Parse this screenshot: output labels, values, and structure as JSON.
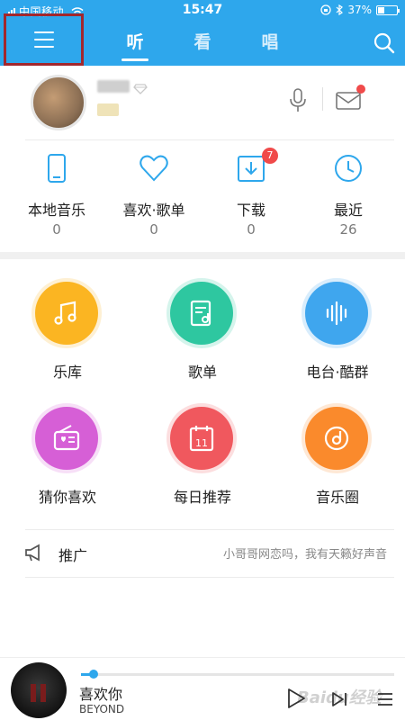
{
  "status_bar": {
    "carrier": "中国移动",
    "time": "15:47",
    "battery_percent": "37%",
    "battery_level": 0.37
  },
  "header": {
    "tabs": [
      {
        "label": "听",
        "active": true
      },
      {
        "label": "看",
        "active": false
      },
      {
        "label": "唱",
        "active": false
      }
    ],
    "icons": [
      "menu-icon",
      "search-icon"
    ]
  },
  "profile": {
    "icons": [
      "avatar",
      "diamond-icon",
      "microphone-icon",
      "mail-icon"
    ]
  },
  "quick_access": [
    {
      "label": "本地音乐",
      "count": "0",
      "icon": "phone-icon"
    },
    {
      "label": "喜欢·歌单",
      "count": "0",
      "icon": "heart-icon"
    },
    {
      "label": "下载",
      "count": "0",
      "icon": "download-icon",
      "badge": "7"
    },
    {
      "label": "最近",
      "count": "26",
      "icon": "clock-icon"
    }
  ],
  "grid": [
    {
      "label": "乐库",
      "icon": "music-note-icon",
      "color": "#fbb522"
    },
    {
      "label": "歌单",
      "icon": "playlist-icon",
      "color": "#2ec7a0"
    },
    {
      "label": "电台·酷群",
      "icon": "soundwave-icon",
      "color": "#3fa6ee"
    },
    {
      "label": "猜你喜欢",
      "icon": "radio-icon",
      "color": "#d65fd6"
    },
    {
      "label": "每日推荐",
      "icon": "calendar-icon",
      "color": "#f0585e",
      "icon_text": "11"
    },
    {
      "label": "音乐圈",
      "icon": "disc-icon",
      "color": "#fa8a2c"
    }
  ],
  "promo": {
    "label": "推广",
    "text": "小哥哥网恋吗，我有天籁好声音",
    "icon": "megaphone-icon"
  },
  "player": {
    "title": "喜欢你",
    "artist": "BEYOND",
    "progress": 0.04,
    "watermark": "Baidu经验"
  }
}
